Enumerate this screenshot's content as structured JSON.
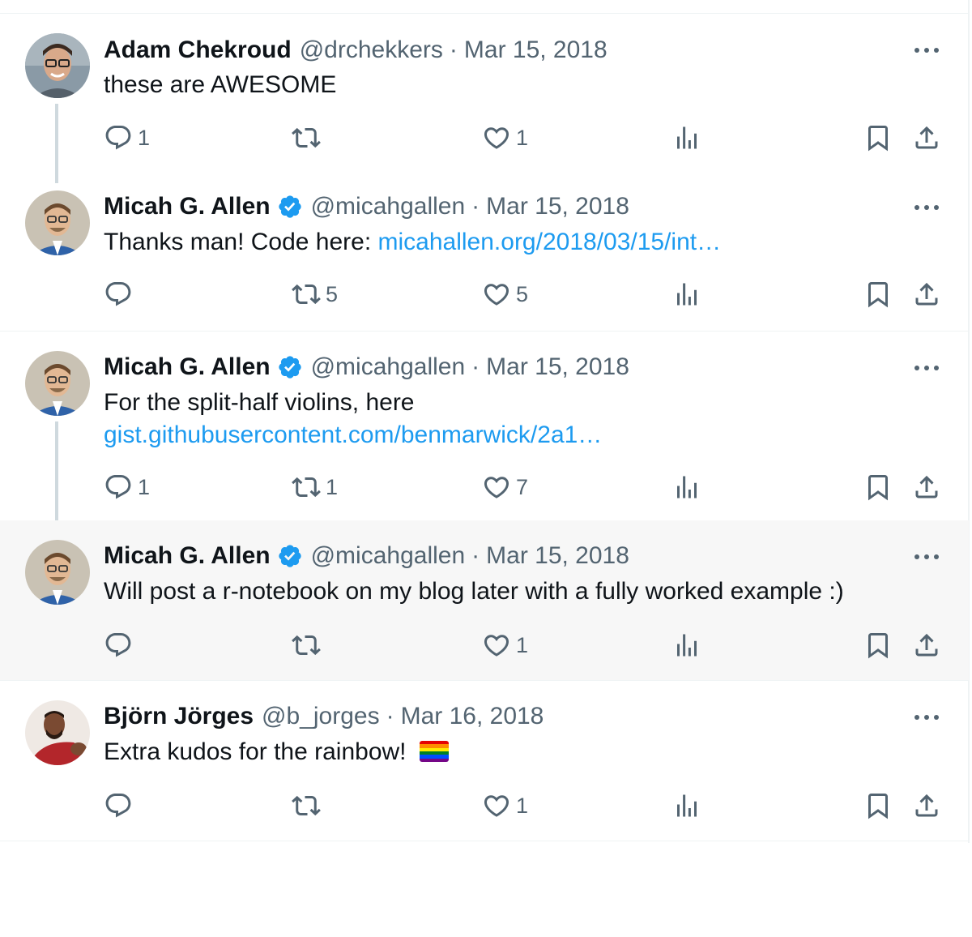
{
  "tweets": [
    {
      "name": "Adam Chekroud",
      "verified": false,
      "handle": "@drchekkers",
      "date": "Mar 15, 2018",
      "text": "these are AWESOME",
      "replies": "1",
      "retweets": "",
      "likes": "1"
    },
    {
      "name": "Micah G. Allen",
      "verified": true,
      "handle": "@micahgallen",
      "date": "Mar 15, 2018",
      "text": "Thanks man! Code here: ",
      "link": "micahallen.org/2018/03/15/int…",
      "replies": "",
      "retweets": "5",
      "likes": "5"
    },
    {
      "name": "Micah G. Allen",
      "verified": true,
      "handle": "@micahgallen",
      "date": "Mar 15, 2018",
      "text": "For the split-half violins, here",
      "link": "gist.githubusercontent.com/benmarwick/2a1…",
      "replies": "1",
      "retweets": "1",
      "likes": "7"
    },
    {
      "name": "Micah G. Allen",
      "verified": true,
      "handle": "@micahgallen",
      "date": "Mar 15, 2018",
      "text": "Will post a r-notebook on my blog later with a fully worked example :)",
      "replies": "",
      "retweets": "",
      "likes": "1"
    },
    {
      "name": "Björn Jörges",
      "verified": false,
      "handle": "@b_jorges",
      "date": "Mar 16, 2018",
      "text": "Extra kudos for the rainbow! ",
      "emoji": "rainbow-flag",
      "replies": "",
      "retweets": "",
      "likes": "1"
    }
  ],
  "ui": {
    "separator": "·"
  },
  "colors": {
    "link": "#1d9bf0",
    "verified": "#1d9bf0",
    "muted": "#536471",
    "highlight_bg": "#f7f7f7"
  },
  "icons": [
    "reply-icon",
    "retweet-icon",
    "like-icon",
    "views-icon",
    "bookmark-icon",
    "share-icon",
    "more-icon",
    "verified-badge-icon",
    "rainbow-flag-emoji"
  ]
}
